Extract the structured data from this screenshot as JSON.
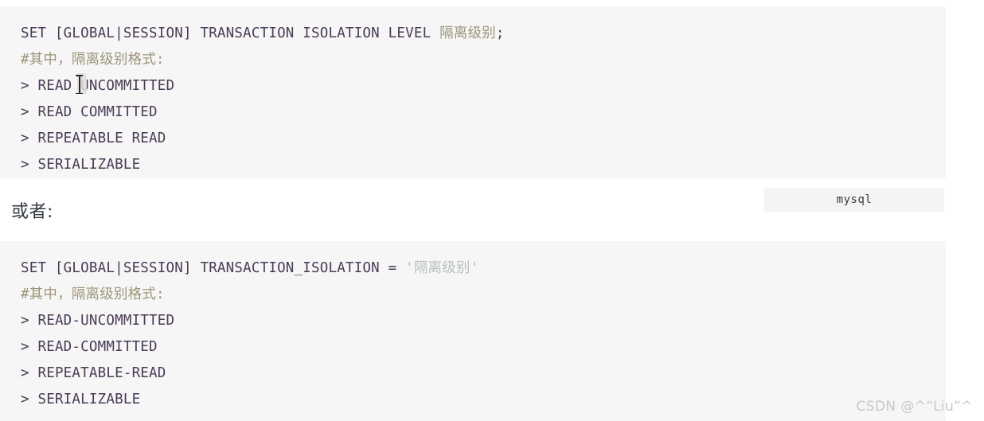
{
  "document": {
    "type": "code-snippet-article",
    "background_color": "#ffffff"
  },
  "code_block_1": {
    "language_label": "mysql",
    "background_color": "#f6f6f6",
    "code_color": "#4b3b56",
    "comment_color": "#9c9478",
    "lines": [
      {
        "parts": [
          {
            "text": "SET [GLOBAL|SESSION] TRANSACTION ISOLATION LEVEL ",
            "token": "plain"
          },
          {
            "text": "隔离级别",
            "token": "zh"
          },
          {
            "text": ";",
            "token": "punct"
          }
        ]
      },
      {
        "parts": [
          {
            "text": "#其中，隔离级别格式:",
            "token": "comment"
          }
        ]
      },
      {
        "parts": [
          {
            "text": "> READ UNCOMMITTED",
            "token": "plain"
          }
        ]
      },
      {
        "parts": [
          {
            "text": "> READ COMMITTED",
            "token": "plain"
          }
        ]
      },
      {
        "parts": [
          {
            "text": "> REPEATABLE READ",
            "token": "plain"
          }
        ]
      },
      {
        "parts": [
          {
            "text": "> SERIALIZABLE",
            "token": "plain"
          }
        ]
      }
    ]
  },
  "paragraph": {
    "text": "或者:"
  },
  "code_block_2": {
    "background_color": "#f6f6f6",
    "string_color": "#b9bfc0",
    "lines": [
      {
        "parts": [
          {
            "text": "SET [GLOBAL|SESSION] TRANSACTION_ISOLATION = ",
            "token": "plain"
          },
          {
            "text": "'隔离级别'",
            "token": "string"
          }
        ]
      },
      {
        "parts": [
          {
            "text": "#其中，隔离级别格式:",
            "token": "comment"
          }
        ]
      },
      {
        "parts": [
          {
            "text": "> READ-UNCOMMITTED",
            "token": "plain"
          }
        ]
      },
      {
        "parts": [
          {
            "text": "> READ-COMMITTED",
            "token": "plain"
          }
        ]
      },
      {
        "parts": [
          {
            "text": "> REPEATABLE-READ",
            "token": "plain"
          }
        ]
      },
      {
        "parts": [
          {
            "text": "> SERIALIZABLE",
            "token": "plain"
          }
        ]
      }
    ]
  },
  "watermark": {
    "text": "CSDN @^“Liu”^",
    "color": "#c9c9c9"
  },
  "cursor": {
    "type": "text-ibeam-caret"
  }
}
